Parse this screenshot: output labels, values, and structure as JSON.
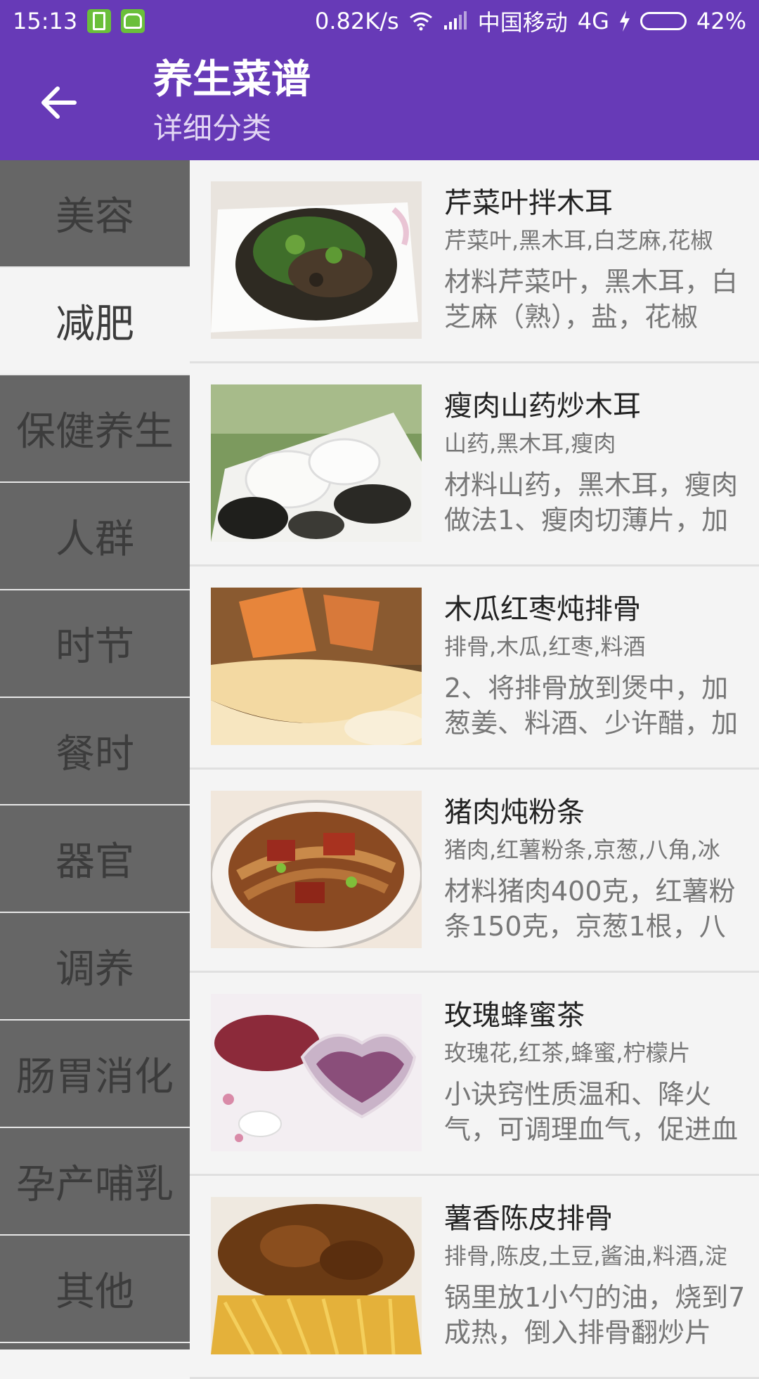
{
  "status_bar": {
    "time": "15:13",
    "speed": "0.82K/s",
    "carrier": "中国移动",
    "network": "4G",
    "battery": "42%",
    "battery_level": 0.42,
    "icons": [
      "battery-notification-icon",
      "android-notification-icon",
      "wifi-icon",
      "signal-icon",
      "charging-icon",
      "battery-icon"
    ]
  },
  "app_bar": {
    "title": "养生菜谱",
    "subtitle": "详细分类",
    "back_icon": "back-arrow-icon"
  },
  "sidebar": {
    "active_index": 1,
    "items": [
      "美容",
      "减肥",
      "保健养生",
      "人群",
      "时节",
      "餐时",
      "器官",
      "调养",
      "肠胃消化",
      "孕产哺乳",
      "其他"
    ]
  },
  "recipes": [
    {
      "title": "芹菜叶拌木耳",
      "ingredients": "芹菜叶,黑木耳,白芝麻,花椒",
      "desc": "材料芹菜叶，黑木耳，白芝麻（熟），盐，花椒"
    },
    {
      "title": "瘦肉山药炒木耳",
      "ingredients": "山药,黑木耳,瘦肉",
      "desc": "材料山药，黑木耳，瘦肉做法1、瘦肉切薄片，加"
    },
    {
      "title": "木瓜红枣炖排骨",
      "ingredients": "排骨,木瓜,红枣,料酒",
      "desc": "2、将排骨放到煲中，加葱姜、料酒、少许醋，加"
    },
    {
      "title": "猪肉炖粉条",
      "ingredients": "猪肉,红薯粉条,京葱,八角,冰",
      "desc": "材料猪肉400克，红薯粉条150克，京葱1根，八"
    },
    {
      "title": "玫瑰蜂蜜茶",
      "ingredients": "玫瑰花,红茶,蜂蜜,柠檬片",
      "desc": "小诀窍性质温和、降火气，可调理血气，促进血"
    },
    {
      "title": "薯香陈皮排骨",
      "ingredients": "排骨,陈皮,土豆,酱油,料酒,淀",
      "desc": "锅里放1小勺的油，烧到7成热，倒入排骨翻炒片"
    }
  ],
  "colors": {
    "primary": "#673ab7",
    "sidebar": "#666666",
    "active_item": "#f4f4f4"
  }
}
